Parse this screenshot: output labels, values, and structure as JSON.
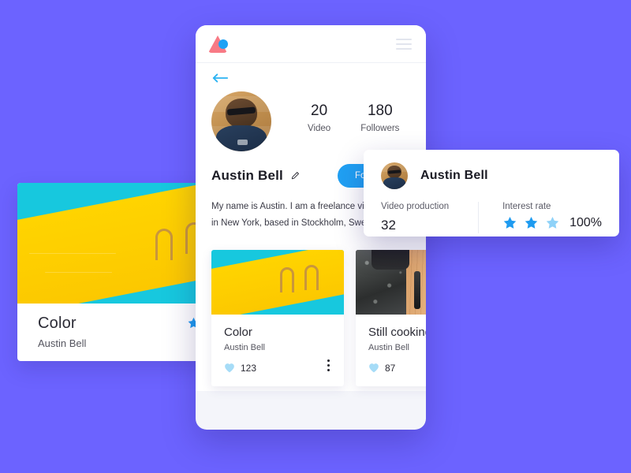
{
  "theme": {
    "background": "#6C63FF",
    "accent_blue": "#20A0F3",
    "star_blue": "#1E9BF0",
    "star_blue_light": "#8FD2F8",
    "heart_blue": "#A6DCF7",
    "logo_pink": "#F87A85",
    "phone_bg": "#F4F5FA",
    "card_white": "#FFFFFF"
  },
  "left_card": {
    "title": "Color",
    "author": "Austin Bell",
    "thumbnail_alt": "swimming-pool-ladder",
    "stars": [
      {
        "name": "star-filled",
        "state": "filled"
      },
      {
        "name": "star-partial",
        "state": "light"
      }
    ]
  },
  "phone": {
    "topbar": {
      "logo_name": "app-logo",
      "menu_name": "hamburger-menu"
    },
    "back_label": "back-arrow",
    "profile": {
      "avatar_alt": "austin-bell-avatar",
      "stats": [
        {
          "value": "20",
          "label": "Video"
        },
        {
          "value": "180",
          "label": "Followers"
        }
      ],
      "name": "Austin Bell",
      "edit_icon": "pencil-icon",
      "follow_button": "Following",
      "bio": "My name is Austin. I am a freelance videomaker in New York, based in Stockholm, Sweden."
    },
    "videos": [
      {
        "title": "Color",
        "author": "Austin Bell",
        "likes": "123",
        "thumbnail_alt": "swimming-pool-ladder",
        "menu_icon": "more-options-icon"
      },
      {
        "title": "Still cooking",
        "author": "Austin Bell",
        "likes": "87",
        "thumbnail_alt": "cooking-flatlay-orange-bread",
        "menu_icon": "more-options-icon"
      }
    ]
  },
  "overlay_card": {
    "avatar_alt": "austin-bell-avatar-small",
    "name": "Austin Bell",
    "left_stat": {
      "label": "Video production",
      "value": "32"
    },
    "right_stat": {
      "label": "Interest rate",
      "percent": "100%",
      "stars": [
        {
          "name": "star-filled",
          "state": "filled"
        },
        {
          "name": "star-filled",
          "state": "filled"
        },
        {
          "name": "star-light",
          "state": "light"
        }
      ]
    }
  }
}
